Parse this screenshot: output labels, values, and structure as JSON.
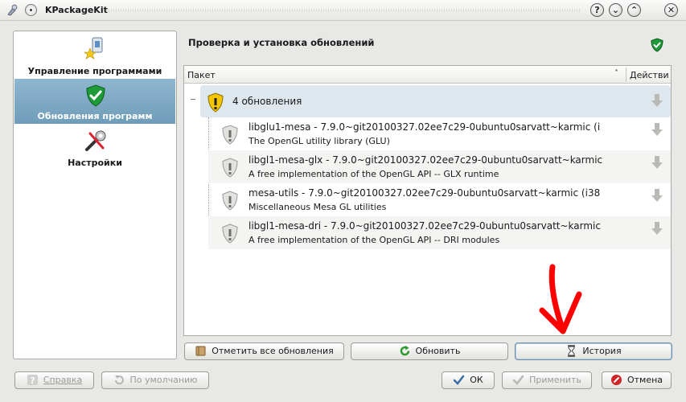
{
  "window": {
    "title": "KPackageKit"
  },
  "titlebar_buttons": [
    "?",
    "⌄",
    "⌃",
    "✕"
  ],
  "sidebar": {
    "items": [
      {
        "label": "Управление программами",
        "icon": "package-manager-icon",
        "active": false
      },
      {
        "label": "Обновления программ",
        "icon": "shield-check-icon",
        "active": true
      },
      {
        "label": "Настройки",
        "icon": "settings-tools-icon",
        "active": false
      }
    ]
  },
  "header": {
    "title": "Проверка и установка обновлений",
    "status_icon": "shield-check-icon"
  },
  "tree": {
    "columns": {
      "package": "Пакет",
      "action": "Действи"
    },
    "group": {
      "label": "4 обновления",
      "icon": "warning-shield-icon"
    },
    "packages": [
      {
        "name": "libglu1-mesa - 7.9.0~git20100327.02ee7c29-0ubuntu0sarvatt~karmic (i",
        "description": "The OpenGL utility library (GLU)"
      },
      {
        "name": "libgl1-mesa-glx - 7.9.0~git20100327.02ee7c29-0ubuntu0sarvatt~karmic",
        "description": "A free implementation of the OpenGL API -- GLX runtime"
      },
      {
        "name": "mesa-utils - 7.9.0~git20100327.02ee7c29-0ubuntu0sarvatt~karmic (i38",
        "description": "Miscellaneous Mesa GL utilities"
      },
      {
        "name": "libgl1-mesa-dri - 7.9.0~git20100327.02ee7c29-0ubuntu0sarvatt~karmic",
        "description": "A free implementation of the OpenGL API -- DRI modules"
      }
    ]
  },
  "actions": {
    "mark_all": "Отметить все обновления",
    "refresh": "Обновить",
    "history": "История"
  },
  "footer": {
    "help": "Справка",
    "defaults": "По умолчанию",
    "ok": "ОК",
    "apply": "Применить",
    "cancel": "Отмена"
  },
  "colors": {
    "selection": "#7aa6c2",
    "group_row": "#dfe7ee",
    "annotation": "#ff0000"
  }
}
